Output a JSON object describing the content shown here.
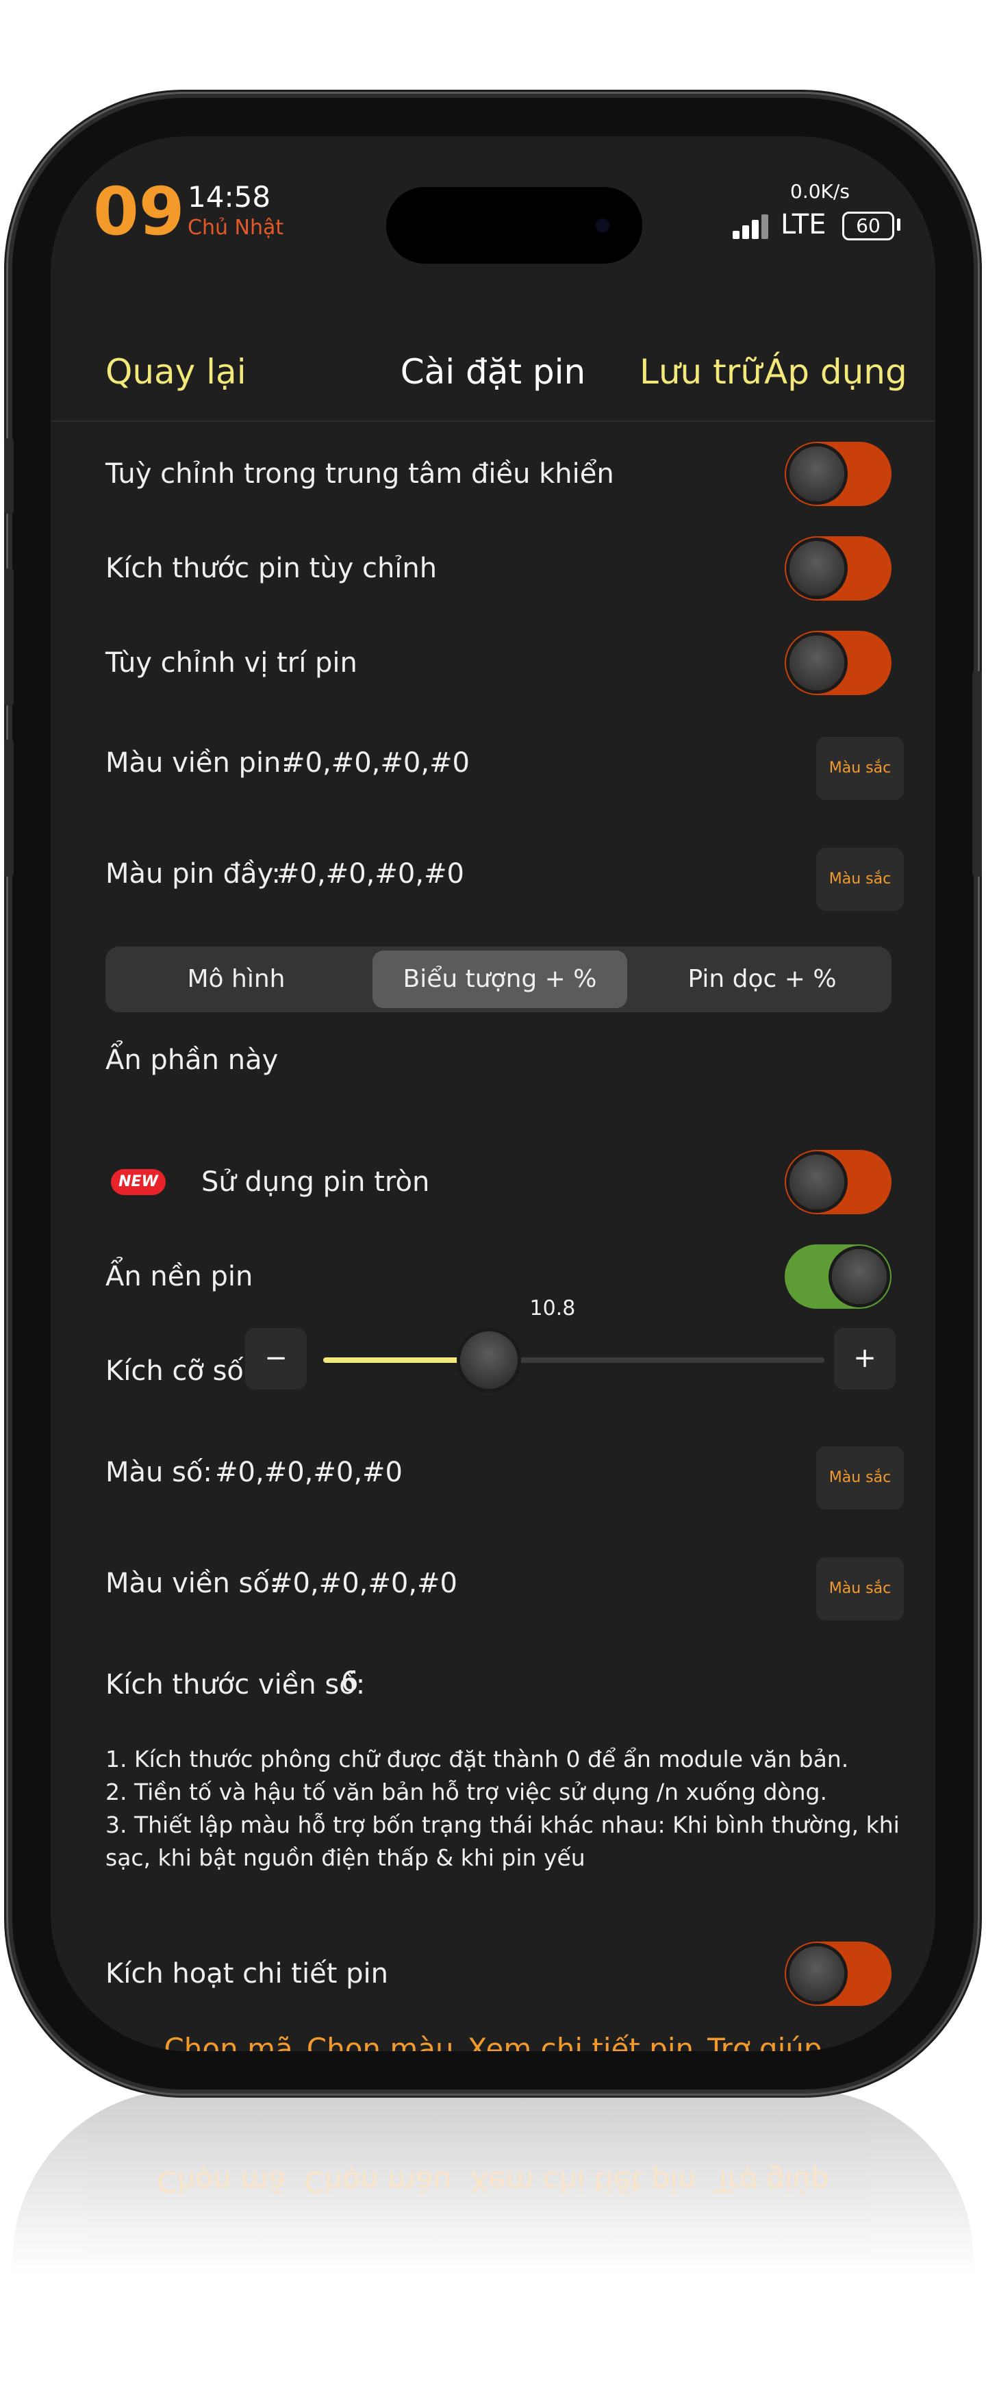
{
  "status_bar": {
    "day": "09",
    "time": "14:58",
    "weekday": "Chủ Nhật",
    "net_speed": "0.0K/s",
    "network": "LTE",
    "battery": "60"
  },
  "header": {
    "back": "Quay lại",
    "title": "Cài đặt pin",
    "save": "Lưu trữ",
    "apply": "Áp dụng"
  },
  "settings": {
    "custom_control_center": {
      "label": "Tuỳ chỉnh trong trung tâm điều khiển",
      "on": false
    },
    "custom_size": {
      "label": "Kích thước pin tùy chỉnh",
      "on": false
    },
    "custom_position": {
      "label": "Tùy chỉnh vị trí pin",
      "on": false
    },
    "border_color": {
      "label": "Màu viền pin:",
      "value": "#0,#0,#0,#0",
      "button": "Màu sắc"
    },
    "full_color": {
      "label": "Màu pin đầy:",
      "value": "#0,#0,#0,#0",
      "button": "Màu sắc"
    }
  },
  "segments": [
    {
      "label": "Mô hình",
      "active": false
    },
    {
      "label": "Biểu tượng + %",
      "active": true
    },
    {
      "label": "Pin dọc + %",
      "active": false
    }
  ],
  "section": {
    "hide_label": "Ẩn phần này",
    "new_badge": "NEW",
    "round_battery": {
      "label": "Sử dụng pin tròn",
      "on": false
    },
    "hide_background": {
      "label": "Ẩn nền pin",
      "on": true
    },
    "font_size": {
      "label": "Kích cỡ số:",
      "value": "10.8",
      "minus": "−",
      "plus": "+",
      "fraction": 0.33
    },
    "number_color": {
      "label": "Màu số:",
      "value": "#0,#0,#0,#0",
      "button": "Màu sắc"
    },
    "number_border_color": {
      "label": "Màu viền số:",
      "value": "#0,#0,#0,#0",
      "button": "Màu sắc"
    },
    "number_border_size": {
      "label": "Kích thước viền số:",
      "value": "6"
    }
  },
  "notes": [
    "1. Kích thước phông chữ được đặt thành 0 để ẩn module văn bản.",
    "2. Tiền tố và hậu tố văn bản hỗ trợ việc sử dụng /n xuống dòng.",
    "3. Thiết lập màu hỗ trợ bốn trạng thái khác nhau: Khi bình thường, khi sạc, khi bật nguồn điện thấp & khi pin yếu"
  ],
  "detail": {
    "label": "Kích hoạt chi tiết pin",
    "on": false
  },
  "footer_links": [
    "Chọn mã",
    "Chọn màu",
    "Xem chi tiết pin",
    "Trợ giúp"
  ],
  "colors": {
    "accent_yellow": "#f2e97a",
    "accent_orange": "#f29a2c",
    "toggle_off": "#c9400a",
    "toggle_on": "#5e9c35",
    "background": "#1f1f1f"
  }
}
